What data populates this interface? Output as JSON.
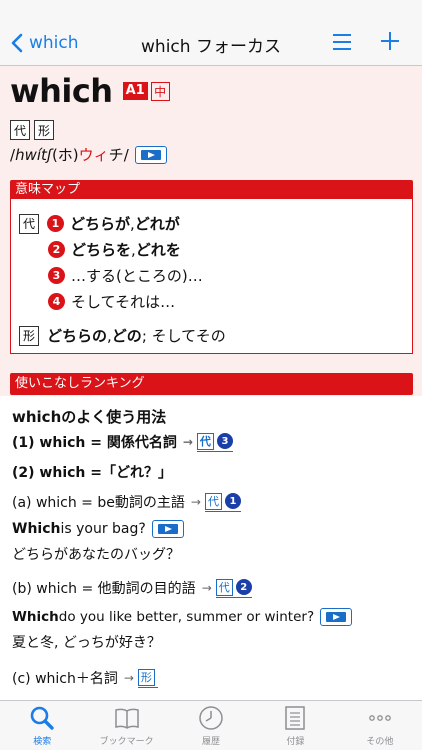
{
  "nav": {
    "back_label": "which",
    "title": "which フォーカス"
  },
  "entry": {
    "headword": "which",
    "level_badge": "A1",
    "school_badge": "中",
    "pos_tags": [
      "代",
      "形"
    ],
    "pron_slash_open": "/",
    "pron_ipa": "hwítʃ",
    "pron_paren": " (ホ)",
    "pron_kana": "ウィ",
    "pron_kana2": "チ",
    "pron_slash_close": "/"
  },
  "meaning_map": {
    "title": "意味マップ",
    "pos1": "代",
    "pos2": "形",
    "items": [
      {
        "num": "1",
        "text_a": "どちらが",
        "sep": ", ",
        "text_b": "どれが"
      },
      {
        "num": "2",
        "text_a": "どちらを",
        "sep": ", ",
        "text_b": "どれを"
      },
      {
        "num": "3",
        "text_a": "…する(ところの)…"
      },
      {
        "num": "4",
        "text_a": "そしてそれは…"
      }
    ],
    "adj_a": "どちらの",
    "adj_sep": ", ",
    "adj_b": "どの",
    "adj_c": "; そしてその"
  },
  "ranking": {
    "title": "使いこなしランキング",
    "subtitle": "whichのよく使う用法",
    "usage1": "(1) which = 関係代名詞",
    "usage1_ref_pos": "代",
    "usage1_ref_num": "3",
    "usage2": "(2) which =「どれ？」",
    "a_label": "(a) which = be動詞の主語",
    "a_ref_pos": "代",
    "a_ref_num": "1",
    "a_ex_bold": "Which",
    "a_ex_rest": " is your bag?",
    "a_ex_ja": "どちらがあなたのバッグ？",
    "b_label": "(b) which = 他動詞の目的語",
    "b_ref_pos": "代",
    "b_ref_num": "2",
    "b_ex_bold": "Which",
    "b_ex_rest": " do you like better, summer or winter?",
    "b_ex_ja": "夏と冬, どっちが好き？",
    "c_label": "(c) which＋名詞",
    "c_ref_pos": "形"
  },
  "tabs": [
    {
      "label": "検索",
      "icon": "search-icon"
    },
    {
      "label": "ブックマーク",
      "icon": "book-icon"
    },
    {
      "label": "履歴",
      "icon": "clock-icon"
    },
    {
      "label": "付録",
      "icon": "document-icon"
    },
    {
      "label": "その他",
      "icon": "more-icon"
    }
  ],
  "colors": {
    "accent_red": "#d91318",
    "ios_blue": "#1a7ee6",
    "content_bg": "#fdeeee"
  }
}
